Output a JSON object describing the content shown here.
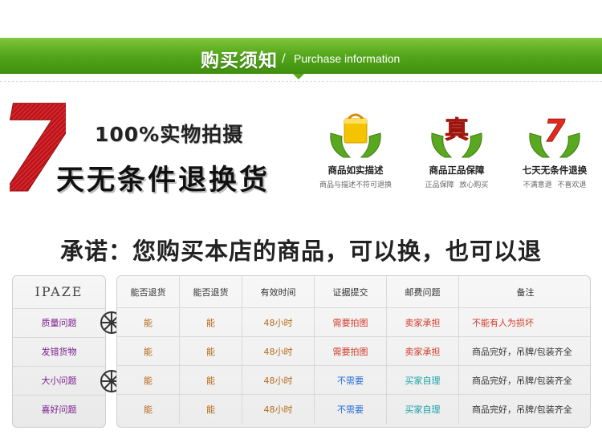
{
  "header": {
    "title": "购买须知",
    "slash": "/",
    "subtitle": "Purchase information"
  },
  "hero": {
    "big_number": "7",
    "slogan_top": "100%实物拍摄",
    "slogan_bottom": "天无条件退换货"
  },
  "features": [
    {
      "icon": "shopping-bag-icon",
      "title": "商品如实描述",
      "subtitle": "商品与描述不符可退换"
    },
    {
      "icon": "genuine-mark-icon",
      "title": "商品正品保障",
      "mark": "真",
      "subtitle": "正品保障 放心购买"
    },
    {
      "icon": "seven-days-icon",
      "title": "七天无条件退换",
      "mark": "7",
      "subtitle": "不满意退 不喜欢退"
    }
  ],
  "promise": "承诺：您购买本店的商品，可以换，也可以退",
  "table": {
    "brand": "IPAZE",
    "headers": [
      "能否退货",
      "能否退货",
      "有效时间",
      "证据提交",
      "邮费问题",
      "备注"
    ],
    "rows": [
      {
        "issue": "质量问题",
        "cells": [
          "能",
          "能",
          "48小时",
          "需要拍图",
          "卖家承担",
          "不能有人为损坏"
        ]
      },
      {
        "issue": "发错货物",
        "cells": [
          "能",
          "能",
          "48小时",
          "需要拍图",
          "卖家承担",
          "商品完好，吊牌/包装齐全"
        ]
      },
      {
        "issue": "大小问题",
        "cells": [
          "能",
          "能",
          "48小时",
          "不需要",
          "买家自理",
          "商品完好，吊牌/包装齐全"
        ]
      },
      {
        "issue": "喜好问题",
        "cells": [
          "能",
          "能",
          "48小时",
          "不需要",
          "买家自理",
          "商品完好，吊牌/包装齐全"
        ]
      }
    ]
  },
  "colors": {
    "banner_green": "#55a81c",
    "issue_purple": "#7a1e8c",
    "value_brown": "#b56a1c",
    "value_red": "#d23a2a",
    "value_blue": "#2a6fd6",
    "value_teal": "#1aa3a8"
  }
}
